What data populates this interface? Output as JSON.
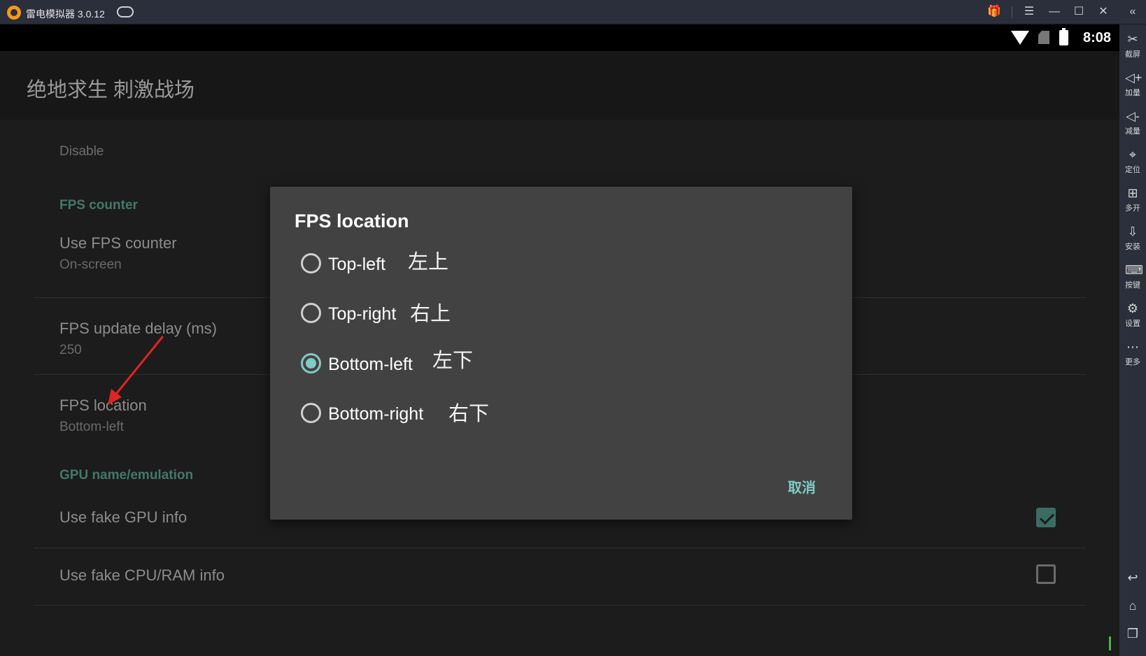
{
  "titlebar": {
    "app_title": "雷电模拟器 3.0.12",
    "icons": [
      "app-logo-icon",
      "gamepad-icon",
      "gift-icon",
      "menu-icon",
      "minimize-icon",
      "maximize-icon",
      "close-icon",
      "collapse-icon"
    ],
    "glyphs": {
      "gift": "🎁",
      "menu": "☰",
      "minimize": "—",
      "maximize": "☐",
      "close": "✕",
      "collapse": "«"
    }
  },
  "statusbar": {
    "time": "8:08"
  },
  "appbar": {
    "title": "绝地求生 刺激战场"
  },
  "settings": {
    "disable_label": "Disable",
    "fps_counter_category": "FPS counter",
    "use_fps_counter": {
      "title": "Use FPS counter",
      "summary": "On-screen"
    },
    "fps_update_delay": {
      "title": "FPS update delay (ms)",
      "summary": "250"
    },
    "fps_location": {
      "title": "FPS location",
      "summary": "Bottom-left"
    },
    "gpu_category": "GPU name/emulation",
    "use_fake_gpu": {
      "title": "Use fake GPU info",
      "checked": true
    },
    "use_fake_cpu_ram": {
      "title": "Use fake CPU/RAM info",
      "checked": false
    }
  },
  "dialog": {
    "title": "FPS location",
    "options": [
      {
        "label": "Top-left",
        "note": "左上",
        "checked": false
      },
      {
        "label": "Top-right",
        "note": "右上",
        "checked": false
      },
      {
        "label": "Bottom-left",
        "note": "左下",
        "checked": true
      },
      {
        "label": "Bottom-right",
        "note": "右下",
        "checked": false
      }
    ],
    "cancel_label": "取消"
  },
  "sidebar": {
    "items": [
      {
        "label": "截屏",
        "icon": "scissors-icon",
        "glyph": "✂"
      },
      {
        "label": "加量",
        "icon": "volume-up-icon",
        "glyph": "◁+"
      },
      {
        "label": "减量",
        "icon": "volume-down-icon",
        "glyph": "◁-"
      },
      {
        "label": "定位",
        "icon": "location-icon",
        "glyph": "⌖"
      },
      {
        "label": "多开",
        "icon": "multi-instance-icon",
        "glyph": "⊞"
      },
      {
        "label": "安装",
        "icon": "apk-install-icon",
        "glyph": "⇩"
      },
      {
        "label": "按键",
        "icon": "keyboard-icon",
        "glyph": "⌨"
      },
      {
        "label": "设置",
        "icon": "settings-icon",
        "glyph": "⚙"
      },
      {
        "label": "更多",
        "icon": "more-icon",
        "glyph": "⋯"
      }
    ],
    "nav": [
      {
        "icon": "back-icon",
        "glyph": "↩"
      },
      {
        "icon": "home-icon",
        "glyph": "⌂"
      },
      {
        "icon": "recents-icon",
        "glyph": "❐"
      }
    ]
  },
  "colors": {
    "accent": "#80cbc4",
    "category": "#41786a",
    "titlebar_bg": "#2b2e3b",
    "dialog_bg": "#424242",
    "annotation_arrow": "#e02424"
  }
}
